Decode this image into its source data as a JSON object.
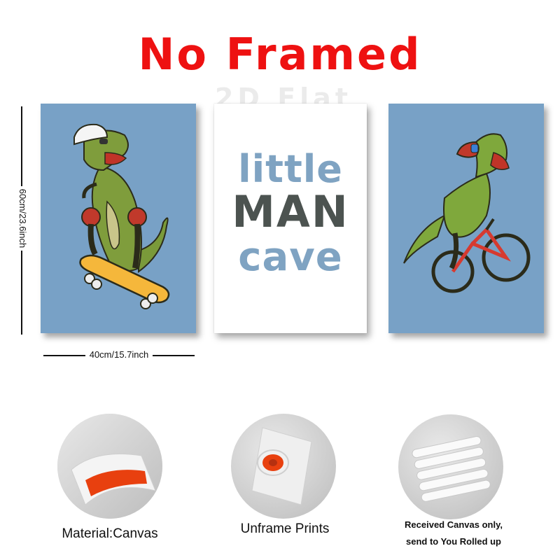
{
  "heading": {
    "title": "No Framed",
    "watermark": "2D Flat"
  },
  "dimensions": {
    "height_label": "60cm/23.6inch",
    "width_label": "40cm/15.7inch"
  },
  "posters": {
    "left": {
      "background": "#78a1c6",
      "subject": "dinosaur-skateboarding"
    },
    "middle": {
      "line1": "little",
      "line2": "MAN",
      "line3": "cave",
      "accent": "#7fa3c2",
      "dark": "#4c5350"
    },
    "right": {
      "background": "#78a1c6",
      "subject": "dinosaur-riding-bicycle"
    }
  },
  "features": [
    {
      "caption": "Material:Canvas",
      "icon": "canvas-material-icon"
    },
    {
      "caption": "Unframe Prints",
      "icon": "rolled-print-icon"
    },
    {
      "caption_line1": "Received Canvas only,",
      "caption_line2": "send to You Rolled up",
      "icon": "rolled-tubes-icon"
    }
  ],
  "colors": {
    "title_red": "#ee1111",
    "inner_orange": "#e8400f"
  }
}
